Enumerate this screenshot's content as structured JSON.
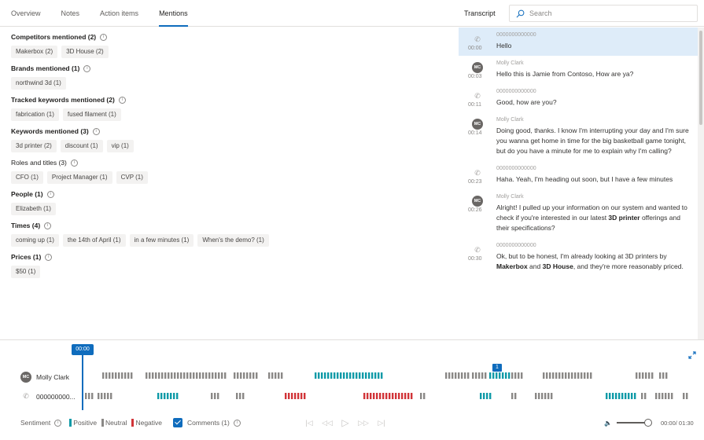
{
  "tabs": [
    "Overview",
    "Notes",
    "Action items",
    "Mentions"
  ],
  "active_tab": "Mentions",
  "transcript_label": "Transcript",
  "search": {
    "placeholder": "Search"
  },
  "mentions": [
    {
      "title": "Competitors mentioned (2)",
      "bold": true,
      "chips": [
        "Makerbox (2)",
        "3D House (2)"
      ]
    },
    {
      "title": "Brands mentioned (1)",
      "bold": true,
      "chips": [
        "northwind 3d (1)"
      ]
    },
    {
      "title": "Tracked keywords mentioned (2)",
      "bold": true,
      "chips": [
        "fabrication (1)",
        "fused filament (1)"
      ]
    },
    {
      "title": "Keywords mentioned (3)",
      "bold": true,
      "chips": [
        "3d printer (2)",
        "discount (1)",
        "vip (1)"
      ]
    },
    {
      "title": "Roles and titles (3)",
      "bold": false,
      "chips": [
        "CFO (1)",
        "Project Manager (1)",
        "CVP (1)"
      ]
    },
    {
      "title": "People (1)",
      "bold": true,
      "chips": [
        "Elizabeth (1)"
      ]
    },
    {
      "title": "Times (4)",
      "bold": true,
      "chips": [
        "coming up (1)",
        "the 14th of April (1)",
        "in a few minutes (1)",
        "When's the demo? (1)"
      ]
    },
    {
      "title": "Prices (1)",
      "bold": true,
      "chips": [
        "$50 (1)"
      ]
    }
  ],
  "transcript": [
    {
      "speaker": "0000000000000",
      "initials": "",
      "time": "00:00",
      "text": "Hello",
      "selected": true
    },
    {
      "speaker": "Molly Clark",
      "initials": "MC",
      "time": "00:03",
      "text": "Hello this is Jamie from Contoso, How are ya?"
    },
    {
      "speaker": "0000000000000",
      "initials": "",
      "time": "00:11",
      "text": "Good, how are you?"
    },
    {
      "speaker": "Molly Clark",
      "initials": "MC",
      "time": "00:14",
      "text": "Doing good, thanks. I know I'm interrupting your day and I'm sure you wanna get home in time for the big basketball game tonight, but do you have a minute for me to explain why I'm calling?"
    },
    {
      "speaker": "0000000000000",
      "initials": "",
      "time": "00:23",
      "text": "Haha. Yeah, I'm heading out soon, but I have a few minutes"
    },
    {
      "speaker": "Molly Clark",
      "initials": "MC",
      "time": "00:26",
      "text_parts": [
        "Alright! I pulled up your information on our system and wanted to check if you're interested in our latest ",
        "3D printer",
        " offerings and their specifications?"
      ]
    },
    {
      "speaker": "0000000000000",
      "initials": "",
      "time": "00:30",
      "text_parts": [
        "Ok, but to be honest, I'm already looking at 3D printers by ",
        "Makerbox",
        " and ",
        "3D House",
        ", and they're more reasonably priced."
      ]
    }
  ],
  "timeline": {
    "current_flag": "00:00",
    "rows": [
      {
        "name": "Molly Clark",
        "initials": "MC"
      },
      {
        "name": "000000000..."
      }
    ],
    "comment_count_marker": "1"
  },
  "legend": {
    "sentiment_label": "Sentiment",
    "positive": "Positive",
    "neutral": "Neutral",
    "negative": "Negative",
    "comments_label": "Comments (1)",
    "colors": {
      "positive": "#0e9aa7",
      "neutral": "#8a8886",
      "negative": "#d13438",
      "accent": "#0f6cbd"
    }
  },
  "player": {
    "icons": [
      "skip-to-start-icon",
      "rewind-icon",
      "play-icon",
      "fast-forward-icon",
      "skip-to-end-icon"
    ],
    "time_display": "00:00/ 01:30"
  }
}
